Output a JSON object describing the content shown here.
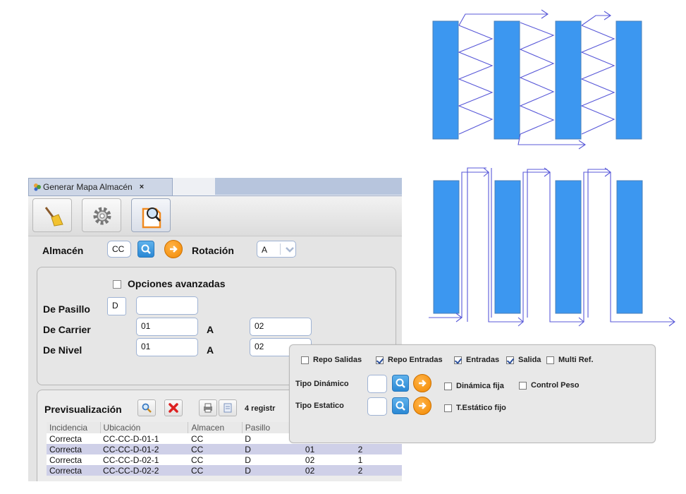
{
  "colors": {
    "rack": "#3c97f0",
    "arrow": "#5858d8",
    "tab_active": "#cdd6e6",
    "row_alt": "#cfd0e8"
  },
  "window": {
    "tab": {
      "title": "Generar Mapa Almacén",
      "close": "×",
      "icon": "warehouse-icon"
    },
    "toolbar": {
      "icons": [
        "broom-icon",
        "gear-icon",
        "preview-icon"
      ]
    }
  },
  "form": {
    "almacen": {
      "label": "Almacén",
      "value": "CC"
    },
    "rotacion": {
      "label": "Rotación",
      "value": "A"
    },
    "advanced_toggle": "Opciones avanzadas",
    "pasillo": {
      "label": "De Pasillo",
      "from": "D",
      "to": ""
    },
    "carrier": {
      "label": "De Carrier",
      "from": "01",
      "sep": "A",
      "to": "02"
    },
    "nivel": {
      "label": "De Nivel",
      "from": "01",
      "sep": "A",
      "to": "02"
    }
  },
  "preview": {
    "title": "Previsualización",
    "count_text": "4 registr",
    "columns": [
      "Incidencia",
      "Ubicación",
      "Almacen",
      "Pasillo"
    ],
    "rows": [
      [
        "Correcta",
        "CC-CC-D-01-1",
        "CC",
        "D",
        "",
        ""
      ],
      [
        "Correcta",
        "CC-CC-D-01-2",
        "CC",
        "D",
        "01",
        "2"
      ],
      [
        "Correcta",
        "CC-CC-D-02-1",
        "CC",
        "D",
        "02",
        "1"
      ],
      [
        "Correcta",
        "CC-CC-D-02-2",
        "CC",
        "D",
        "02",
        "2"
      ]
    ]
  },
  "advanced_panel": {
    "checks": [
      {
        "label": "Repo Salidas",
        "checked": false
      },
      {
        "label": "Repo Entradas",
        "checked": true
      },
      {
        "label": "Entradas",
        "checked": true
      },
      {
        "label": "Salida",
        "checked": true
      },
      {
        "label": "Multi Ref.",
        "checked": false
      }
    ],
    "tipo_dinamico": "Tipo Dinámico",
    "dinamica_fija": "Dinámica fija",
    "control_peso": "Control Peso",
    "tipo_estatico": "Tipo Estatico",
    "estatico_fijo": "T.Estático fijo"
  }
}
